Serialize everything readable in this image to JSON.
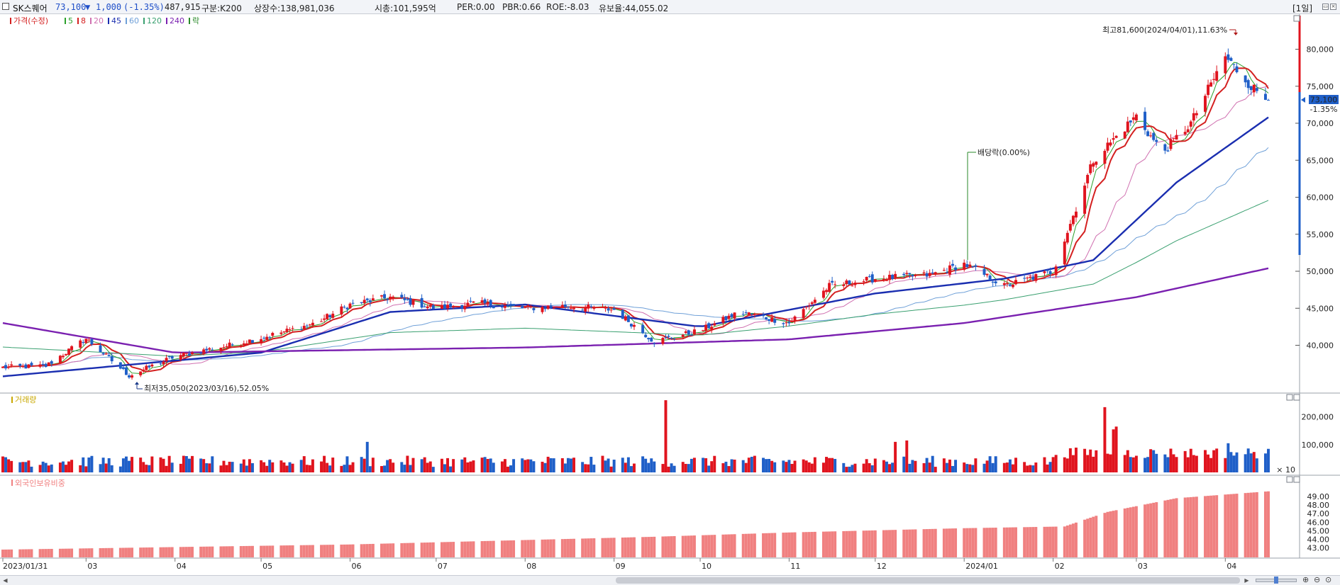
{
  "header": {
    "stock_name": "SK스퀘어",
    "price": "73,100",
    "change_arrow": "▼",
    "change": "1,000",
    "change_pct": "(-1.35%)",
    "volume": "487,915",
    "class_text": "구분:K200",
    "shares_text": "상장수:138,981,036",
    "mktcap_text": "시총:101,595억",
    "per_text": "PER:0.00",
    "pbr_text": "PBR:0.66",
    "roe_text": "ROE:-8.03",
    "float_text": "유보율:44,055.02",
    "period_label": "[1일]"
  },
  "price_panel": {
    "legend": [
      {
        "label": "가격(수정)",
        "color": "#d42020"
      },
      {
        "label": "5",
        "color": "#2aa02a"
      },
      {
        "label": "8",
        "color": "#d42020"
      },
      {
        "label": "20",
        "color": "#d070b0"
      },
      {
        "label": "45",
        "color": "#1a2eb0"
      },
      {
        "label": "60",
        "color": "#6fa0d8"
      },
      {
        "label": "120",
        "color": "#3aa070"
      },
      {
        "label": "240",
        "color": "#7a20b0"
      },
      {
        "label": "락",
        "color": "#2a8a2a"
      }
    ],
    "price_ticks": [
      "80,000",
      "75,000",
      "70,000",
      "65,000",
      "60,000",
      "55,000",
      "50,000",
      "45,000",
      "40,000"
    ],
    "current_price_tag": "73,100",
    "current_change_tag": "-1.35%",
    "annotation_high": "최고81,600(2024/04/01),11.63%",
    "annotation_low": "최저35,050(2023/03/16),52.05%",
    "annotation_dividend": "배당락(0.00%)"
  },
  "volume_panel": {
    "legend": "거래량",
    "ticks": [
      "200,000",
      "100,000"
    ],
    "multiplier": "× 10"
  },
  "foreign_panel": {
    "legend": "외국인보유비중",
    "ticks": [
      "49.00",
      "48.00",
      "47.00",
      "46.00",
      "45.00",
      "44.00",
      "43.00"
    ]
  },
  "x_axis_labels": [
    "2023/01/31",
    "03",
    "04",
    "05",
    "06",
    "07",
    "08",
    "09",
    "10",
    "11",
    "12",
    "2024/01",
    "02",
    "03",
    "04"
  ],
  "colors": {
    "up": "#e0141e",
    "down": "#1f5fc8",
    "foreign_bar": "#f08080",
    "ma5": "#2aa02a",
    "ma8": "#d42020",
    "ma20": "#d070b0",
    "ma45": "#1a2eb0",
    "ma60": "#6fa0d8",
    "ma120": "#3aa070",
    "ma240": "#7a20b0",
    "dividend_marker": "#2a8a2a",
    "annotation_high": "#b01818",
    "annotation_low": "#1a3a8a"
  },
  "chart_data": {
    "type": "candlestick",
    "title": "SK스퀘어",
    "x_range": [
      "2023/01/31",
      "2024/04"
    ],
    "y_range_price": [
      35000,
      82000
    ],
    "closing_price_anchors": [
      {
        "x": "2023/01/31",
        "y": 37000
      },
      {
        "x": "2023/02/15",
        "y": 37200
      },
      {
        "x": "2023/03/01",
        "y": 40900
      },
      {
        "x": "2023/03/16",
        "y": 35900
      },
      {
        "x": "2023/04/01",
        "y": 38500
      },
      {
        "x": "2023/04/20",
        "y": 40000
      },
      {
        "x": "2023/05/01",
        "y": 41000
      },
      {
        "x": "2023/05/20",
        "y": 43000
      },
      {
        "x": "2023/06/01",
        "y": 45500
      },
      {
        "x": "2023/06/15",
        "y": 46500
      },
      {
        "x": "2023/07/01",
        "y": 45000
      },
      {
        "x": "2023/07/15",
        "y": 45700
      },
      {
        "x": "2023/08/01",
        "y": 45000
      },
      {
        "x": "2023/08/15",
        "y": 45300
      },
      {
        "x": "2023/09/01",
        "y": 44800
      },
      {
        "x": "2023/09/15",
        "y": 40500
      },
      {
        "x": "2023/10/01",
        "y": 42000
      },
      {
        "x": "2023/10/15",
        "y": 44500
      },
      {
        "x": "2023/11/01",
        "y": 43000
      },
      {
        "x": "2023/11/15",
        "y": 48000
      },
      {
        "x": "2023/12/01",
        "y": 49000
      },
      {
        "x": "2023/12/20",
        "y": 49500
      },
      {
        "x": "2024/01/01",
        "y": 51000
      },
      {
        "x": "2024/01/15",
        "y": 48000
      },
      {
        "x": "2024/02/01",
        "y": 50000
      },
      {
        "x": "2024/02/15",
        "y": 65000
      },
      {
        "x": "2024/03/01",
        "y": 71000
      },
      {
        "x": "2024/03/10",
        "y": 66000
      },
      {
        "x": "2024/03/20",
        "y": 70000
      },
      {
        "x": "2024/04/01",
        "y": 79000
      },
      {
        "x": "2024/04/10",
        "y": 75000
      },
      {
        "x": "2024/04/16",
        "y": 73100
      }
    ],
    "moving_averages": [
      {
        "name": "45",
        "points": [
          {
            "x": "2023/01/31",
            "y": 35800
          },
          {
            "x": "2023/05/01",
            "y": 39000
          },
          {
            "x": "2023/06/15",
            "y": 44500
          },
          {
            "x": "2023/08/01",
            "y": 45500
          },
          {
            "x": "2023/10/01",
            "y": 42500
          },
          {
            "x": "2023/12/01",
            "y": 47000
          },
          {
            "x": "2024/01/15",
            "y": 49000
          },
          {
            "x": "2024/02/15",
            "y": 51500
          },
          {
            "x": "2024/03/15",
            "y": 62000
          },
          {
            "x": "2024/04/16",
            "y": 70800
          }
        ]
      },
      {
        "name": "240",
        "points": [
          {
            "x": "2023/01/31",
            "y": 43000
          },
          {
            "x": "2023/04/01",
            "y": 39000
          },
          {
            "x": "2023/08/01",
            "y": 39700
          },
          {
            "x": "2023/11/01",
            "y": 40800
          },
          {
            "x": "2024/01/01",
            "y": 43000
          },
          {
            "x": "2024/03/01",
            "y": 46500
          },
          {
            "x": "2024/04/16",
            "y": 50400
          }
        ]
      }
    ],
    "volume_range": [
      0,
      250000
    ],
    "foreign_ratio_range": [
      42.5,
      50.0
    ],
    "foreign_ratio_anchors": [
      {
        "x": "2023/01/31",
        "y": 42.8
      },
      {
        "x": "2023/06/01",
        "y": 43.4
      },
      {
        "x": "2023/09/15",
        "y": 44.3
      },
      {
        "x": "2023/11/01",
        "y": 44.8
      },
      {
        "x": "2024/01/01",
        "y": 45.3
      },
      {
        "x": "2024/02/05",
        "y": 45.5
      },
      {
        "x": "2024/02/20",
        "y": 47.2
      },
      {
        "x": "2024/03/15",
        "y": 48.8
      },
      {
        "x": "2024/04/16",
        "y": 49.6
      }
    ],
    "annotations": [
      {
        "text": "최고81,600(2024/04/01),11.63%",
        "date": "2024/04/01",
        "value": 81600
      },
      {
        "text": "최저35,050(2023/03/16),52.05%",
        "date": "2023/03/16",
        "value": 35050
      },
      {
        "text": "배당락(0.00%)",
        "date": "2023/12/27"
      }
    ],
    "xlabel": "",
    "ylabel": ""
  }
}
